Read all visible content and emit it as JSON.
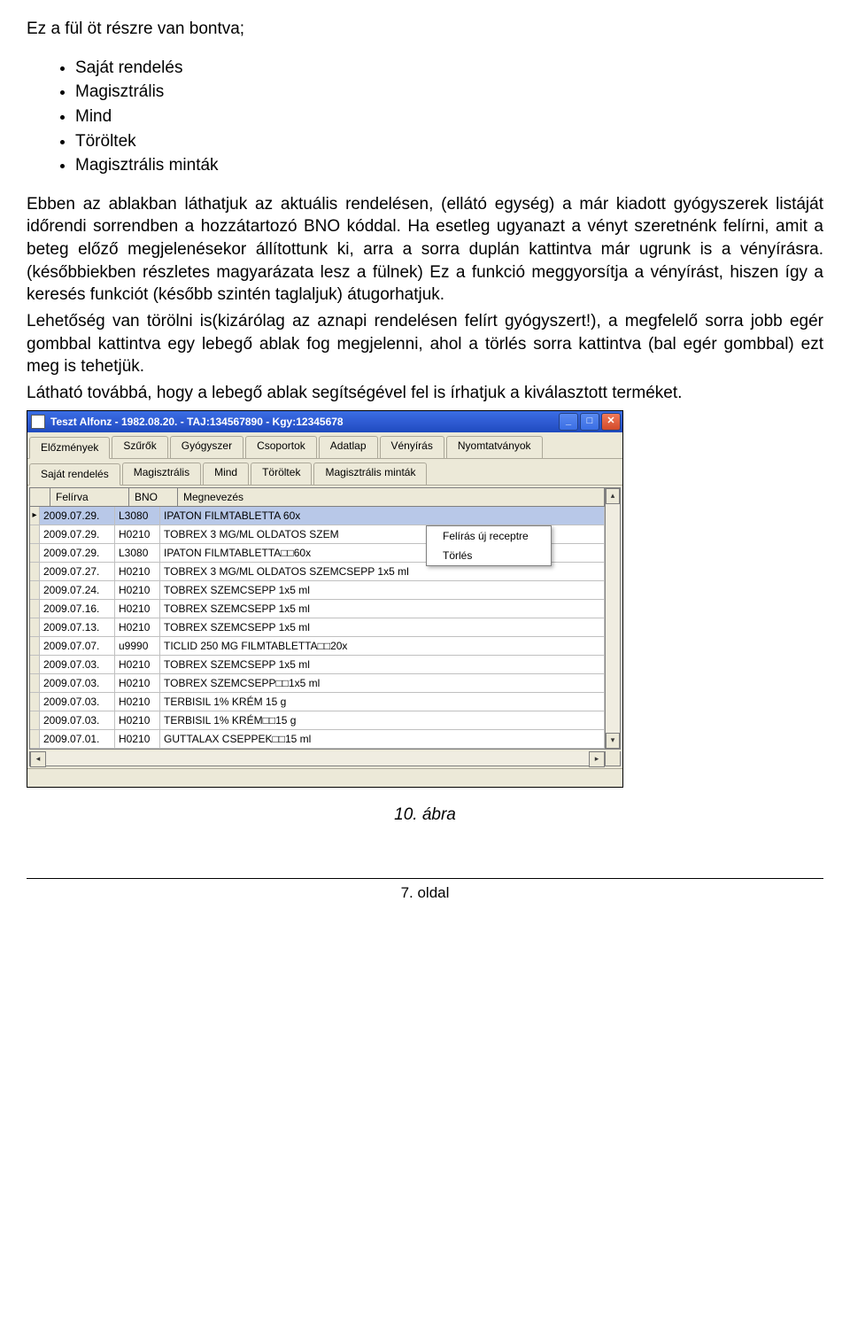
{
  "doc": {
    "intro": "Ez a fül öt részre van bontva;",
    "bullets": [
      "Saját rendelés",
      "Magisztrális",
      "Mind",
      "Töröltek",
      "Magisztrális minták"
    ],
    "p1": "Ebben az ablakban láthatjuk az aktuális rendelésen, (ellátó egység) a már kiadott gyógyszerek listáját időrendi sorrendben a hozzátartozó BNO kóddal. Ha esetleg ugyanazt a vényt szeretnénk felírni, amit a beteg előző megjelenésekor állítottunk ki, arra a sorra duplán kattintva már ugrunk is a vényírásra. (későbbiekben részletes magyarázata lesz a fülnek) Ez a funkció meggyorsítja a vényírást, hiszen így a keresés funkciót (később szintén taglaljuk) átugorhatjuk.",
    "p2": "Lehetőség van törölni is(kizárólag az aznapi rendelésen felírt gyógyszert!), a megfelelő sorra jobb egér gombbal kattintva egy lebegő ablak fog megjelenni, ahol a törlés sorra kattintva (bal egér gombbal) ezt meg is tehetjük.",
    "p3": "Látható továbbá, hogy a lebegő ablak segítségével fel is írhatjuk a kiválasztott terméket.",
    "caption": "10. ábra",
    "page": "7. oldal"
  },
  "win": {
    "title": "Teszt Alfonz - 1982.08.20. - TAJ:134567890 - Kgy:12345678",
    "tabs1": [
      "Előzmények",
      "Szűrők",
      "Gyógyszer",
      "Csoportok",
      "Adatlap",
      "Vényírás",
      "Nyomtatványok"
    ],
    "tabs2": [
      "Saját rendelés",
      "Magisztrális",
      "Mind",
      "Töröltek",
      "Magisztrális minták"
    ],
    "cols": {
      "fel": "Felírva",
      "bno": "BNO",
      "meg": "Megnevezés"
    },
    "rows": [
      {
        "fel": "2009.07.29.",
        "bno": "L3080",
        "meg": "IPATON FILMTABLETTA 60x"
      },
      {
        "fel": "2009.07.29.",
        "bno": "H0210",
        "meg": "TOBREX 3 MG/ML OLDATOS SZEM"
      },
      {
        "fel": "2009.07.29.",
        "bno": "L3080",
        "meg": "IPATON FILMTABLETTA□□60x"
      },
      {
        "fel": "2009.07.27.",
        "bno": "H0210",
        "meg": "TOBREX 3 MG/ML OLDATOS SZEMCSEPP 1x5 ml"
      },
      {
        "fel": "2009.07.24.",
        "bno": "H0210",
        "meg": "TOBREX SZEMCSEPP 1x5 ml"
      },
      {
        "fel": "2009.07.16.",
        "bno": "H0210",
        "meg": "TOBREX SZEMCSEPP 1x5 ml"
      },
      {
        "fel": "2009.07.13.",
        "bno": "H0210",
        "meg": "TOBREX SZEMCSEPP 1x5 ml"
      },
      {
        "fel": "2009.07.07.",
        "bno": "u9990",
        "meg": "TICLID 250 MG FILMTABLETTA□□20x"
      },
      {
        "fel": "2009.07.03.",
        "bno": "H0210",
        "meg": "TOBREX SZEMCSEPP 1x5 ml"
      },
      {
        "fel": "2009.07.03.",
        "bno": "H0210",
        "meg": "TOBREX SZEMCSEPP□□1x5 ml"
      },
      {
        "fel": "2009.07.03.",
        "bno": "H0210",
        "meg": "TERBISIL 1% KRÉM 15 g"
      },
      {
        "fel": "2009.07.03.",
        "bno": "H0210",
        "meg": "TERBISIL 1% KRÉM□□15 g"
      },
      {
        "fel": "2009.07.01.",
        "bno": "H0210",
        "meg": "GUTTALAX CSEPPEK□□15 ml"
      }
    ],
    "ctx": {
      "item1": "Felírás új receptre",
      "item2": "Törlés"
    }
  }
}
